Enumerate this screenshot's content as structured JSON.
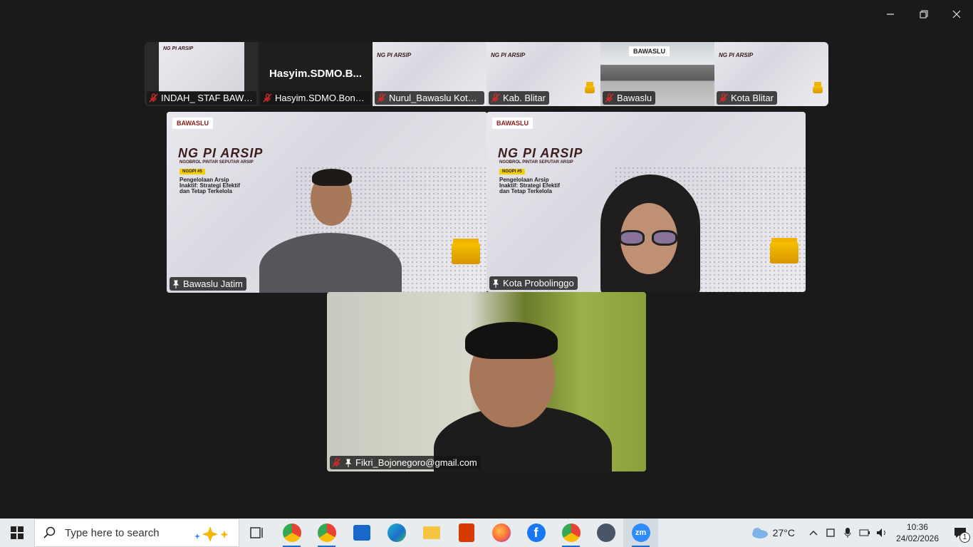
{
  "strip": {
    "participants": [
      {
        "label": "INDAH_ STAF BAWASL...",
        "muted": true
      },
      {
        "label": "Hasyim.SDMO.Bondw...",
        "display_name": "Hasyim.SDMO.B...",
        "muted": true
      },
      {
        "label": "Nurul_Bawaslu Kota P...",
        "muted": true
      },
      {
        "label": "Kab. Blitar",
        "muted": true
      },
      {
        "label": "Bawaslu",
        "muted": true,
        "sign": "BAWASLU"
      },
      {
        "label": "Kota Blitar",
        "muted": true
      }
    ]
  },
  "poster": {
    "brand": "BAWASLU",
    "title": "NG  PI ARSIP",
    "subtitle": "NGOBROL PINTAR SEPUTAR ARSIP",
    "tag": "NGOPI #5",
    "desc": "Pengelolaan Arsip Inaktif: Strategi Efektif dan Tetap Terkelola"
  },
  "gallery": {
    "tiles": [
      {
        "label": "Bawaslu Jatim",
        "pinned": true,
        "active": true
      },
      {
        "label": "Kota Probolinggo",
        "pinned": true
      },
      {
        "label": "Fikri_Bojonegoro@gmail.com",
        "pinned": true,
        "muted": true
      }
    ]
  },
  "taskbar": {
    "search_placeholder": "Type here to search",
    "weather_temp": "27°C",
    "time": "10:36",
    "date": "24/02/2026",
    "notification_count": "1"
  },
  "colors": {
    "active_speaker": "#23d959",
    "mute_red": "#e02828",
    "background": "#1a1a1a"
  }
}
